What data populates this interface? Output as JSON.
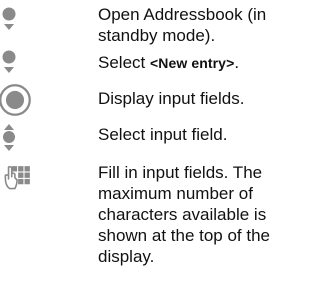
{
  "steps": [
    {
      "icon": "nav-down-icon",
      "text": "Open Addressbook (in standby mode)."
    },
    {
      "icon": "nav-down-icon",
      "prefix": "Select ",
      "code": "<New entry>",
      "suffix": "."
    },
    {
      "icon": "nav-center-select-icon",
      "text": "Display input fields."
    },
    {
      "icon": "nav-up-down-icon",
      "text": "Select input field."
    },
    {
      "icon": "keypad-press-icon",
      "text": "Fill in input fields. The maximum number of characters available is shown at the top of the display."
    }
  ]
}
